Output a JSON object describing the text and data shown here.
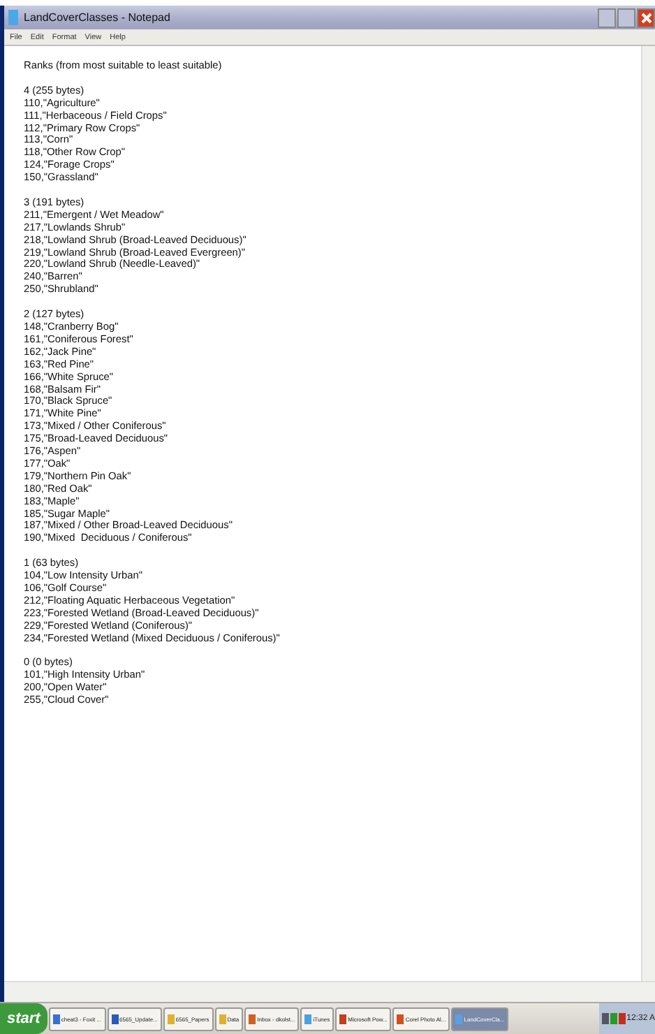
{
  "window": {
    "title": "LandCoverClasses - Notepad"
  },
  "menu": [
    "File",
    "Edit",
    "Format",
    "View",
    "Help"
  ],
  "document": {
    "heading": "Ranks (from most suitable to least suitable)",
    "sections": [
      {
        "heading": "4 (255 bytes)",
        "lines": [
          "110,\"Agriculture\"",
          "111,\"Herbaceous / Field Crops\"",
          "112,\"Primary Row Crops\"",
          "113,\"Corn\"",
          "118,\"Other Row Crop\"",
          "124,\"Forage Crops\"",
          "150,\"Grassland\""
        ]
      },
      {
        "heading": "3 (191 bytes)",
        "lines": [
          "211,\"Emergent / Wet Meadow\"",
          "217,\"Lowlands Shrub\"",
          "218,\"Lowland Shrub (Broad-Leaved Deciduous)\"",
          "219,\"Lowland Shrub (Broad-Leaved Evergreen)\"",
          "220,\"Lowland Shrub (Needle-Leaved)\"",
          "240,\"Barren\"",
          "250,\"Shrubland\""
        ]
      },
      {
        "heading": "2 (127 bytes)",
        "lines": [
          "148,\"Cranberry Bog\"",
          "161,\"Coniferous Forest\"",
          "162,\"Jack Pine\"",
          "163,\"Red Pine\"",
          "166,\"White Spruce\"",
          "168,\"Balsam Fir\"",
          "170,\"Black Spruce\"",
          "171,\"White Pine\"",
          "173,\"Mixed / Other Coniferous\"",
          "175,\"Broad-Leaved Deciduous\"",
          "176,\"Aspen\"",
          "177,\"Oak\"",
          "179,\"Northern Pin Oak\"",
          "180,\"Red Oak\"",
          "183,\"Maple\"",
          "185,\"Sugar Maple\"",
          "187,\"Mixed / Other Broad-Leaved Deciduous\"",
          "190,\"Mixed  Deciduous / Coniferous\""
        ]
      },
      {
        "heading": "1 (63 bytes)",
        "lines": [
          "104,\"Low Intensity Urban\"",
          "106,\"Golf Course\"",
          "212,\"Floating Aquatic Herbaceous Vegetation\"",
          "223,\"Forested Wetland (Broad-Leaved Deciduous)\"",
          "229,\"Forested Wetland (Coniferous)\"",
          "234,\"Forested Wetland (Mixed Deciduous / Coniferous)\""
        ]
      },
      {
        "heading": "0 (0 bytes)",
        "lines": [
          "101,\"High Intensity Urban\"",
          "200,\"Open Water\"",
          "255,\"Cloud Cover\""
        ]
      }
    ]
  },
  "taskbar": {
    "start": "start",
    "items": [
      {
        "label": "cheat3 - Foxit ...",
        "selected": false
      },
      {
        "label": "6565_Update...",
        "selected": false
      },
      {
        "label": "6565_Papers",
        "selected": false
      },
      {
        "label": "Data",
        "selected": false
      },
      {
        "label": "Inbox - dkolst...",
        "selected": false
      },
      {
        "label": "iTunes",
        "selected": false
      },
      {
        "label": "Microsoft Pow...",
        "selected": false
      },
      {
        "label": "Corel Photo Al...",
        "selected": false
      },
      {
        "label": "LandCoverCla...",
        "selected": true
      }
    ],
    "clock": "12:32 A"
  }
}
